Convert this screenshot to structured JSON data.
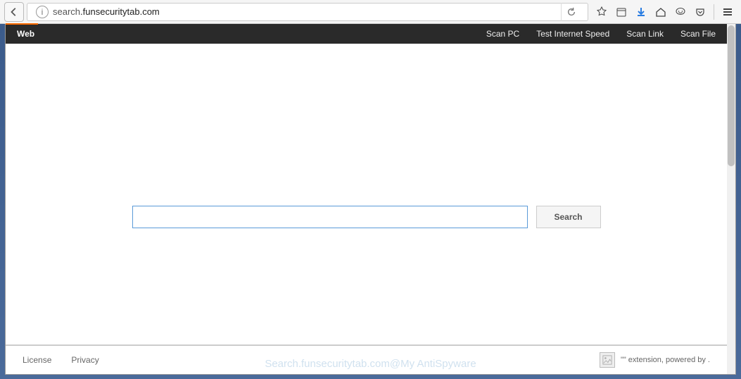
{
  "browser": {
    "url_prefix": "search",
    "url_suffix": ".funsecuritytab.com"
  },
  "topbar": {
    "left_label": "Web",
    "right_links": [
      "Scan PC",
      "Test Internet Speed",
      "Scan Link",
      "Scan File"
    ]
  },
  "search": {
    "button_label": "Search",
    "input_value": ""
  },
  "footer": {
    "links": [
      "License",
      "Privacy"
    ],
    "right_text": "\"\" extension, powered by ."
  },
  "watermark": "Search.funsecuritytab.com@My AntiSpyware"
}
